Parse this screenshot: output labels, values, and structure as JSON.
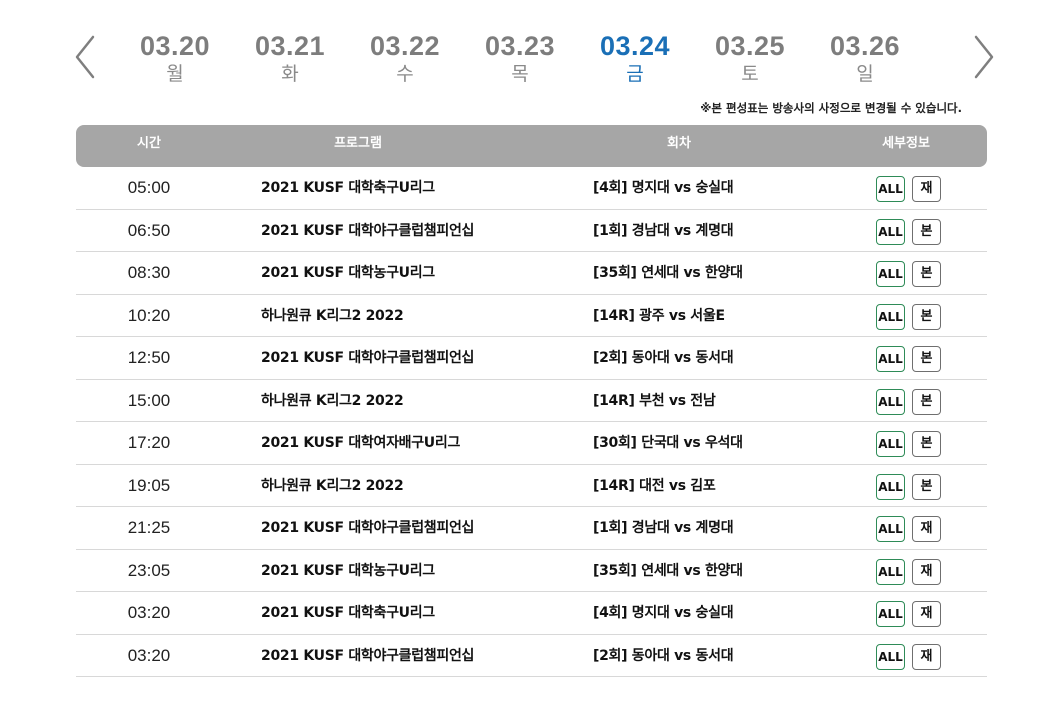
{
  "nav": {
    "prev_icon": "chevron-left-icon",
    "next_icon": "chevron-right-icon",
    "arrow_color": "#7f7f7f"
  },
  "dates": [
    {
      "date": "03.20",
      "day": "월",
      "active": false
    },
    {
      "date": "03.21",
      "day": "화",
      "active": false
    },
    {
      "date": "03.22",
      "day": "수",
      "active": false
    },
    {
      "date": "03.23",
      "day": "목",
      "active": false
    },
    {
      "date": "03.24",
      "day": "금",
      "active": true
    },
    {
      "date": "03.25",
      "day": "토",
      "active": false
    },
    {
      "date": "03.26",
      "day": "일",
      "active": false
    }
  ],
  "colors": {
    "active_date": "#1a6fb6",
    "inactive_date": "#7d7d7d",
    "header_bg": "#a6a6a6",
    "all_button_border": "#2e8b57"
  },
  "notice": "※본 편성표는 방송사의 사정으로 변경될 수 있습니다.",
  "table": {
    "headers": {
      "time": "시간",
      "program": "프로그램",
      "episode": "회차",
      "info": "세부정보"
    },
    "rows": [
      {
        "time": "05:00",
        "program": "2021 KUSF 대학축구U리그",
        "episode": "[4회] 명지대 vs 숭실대",
        "all": "ALL",
        "type": "재"
      },
      {
        "time": "06:50",
        "program": "2021 KUSF 대학야구클럽챔피언십",
        "episode": "[1회] 경남대 vs 계명대",
        "all": "ALL",
        "type": "본"
      },
      {
        "time": "08:30",
        "program": "2021 KUSF 대학농구U리그",
        "episode": "[35회] 연세대 vs 한양대",
        "all": "ALL",
        "type": "본"
      },
      {
        "time": "10:20",
        "program": "하나원큐 K리그2 2022",
        "episode": "[14R]   광주 vs 서울E",
        "all": "ALL",
        "type": "본"
      },
      {
        "time": "12:50",
        "program": "2021 KUSF 대학야구클럽챔피언십",
        "episode": "[2회] 동아대 vs 동서대",
        "all": "ALL",
        "type": "본"
      },
      {
        "time": "15:00",
        "program": "하나원큐 K리그2 2022",
        "episode": "[14R]   부천 vs 전남",
        "all": "ALL",
        "type": "본"
      },
      {
        "time": "17:20",
        "program": "2021 KUSF 대학여자배구U리그",
        "episode": "[30회] 단국대 vs 우석대",
        "all": "ALL",
        "type": "본"
      },
      {
        "time": "19:05",
        "program": "하나원큐 K리그2 2022",
        "episode": "[14R]   대전 vs 김포",
        "all": "ALL",
        "type": "본"
      },
      {
        "time": "21:25",
        "program": "2021 KUSF 대학야구클럽챔피언십",
        "episode": "[1회] 경남대 vs 계명대",
        "all": "ALL",
        "type": "재"
      },
      {
        "time": "23:05",
        "program": "2021 KUSF 대학농구U리그",
        "episode": "[35회] 연세대 vs 한양대",
        "all": "ALL",
        "type": "재"
      },
      {
        "time": "03:20",
        "program": "2021 KUSF 대학축구U리그",
        "episode": "[4회] 명지대 vs 숭실대",
        "all": "ALL",
        "type": "재"
      },
      {
        "time": "03:20",
        "program": "2021 KUSF 대학야구클럽챔피언십",
        "episode": "[2회] 동아대 vs 동서대",
        "all": "ALL",
        "type": "재"
      }
    ]
  }
}
